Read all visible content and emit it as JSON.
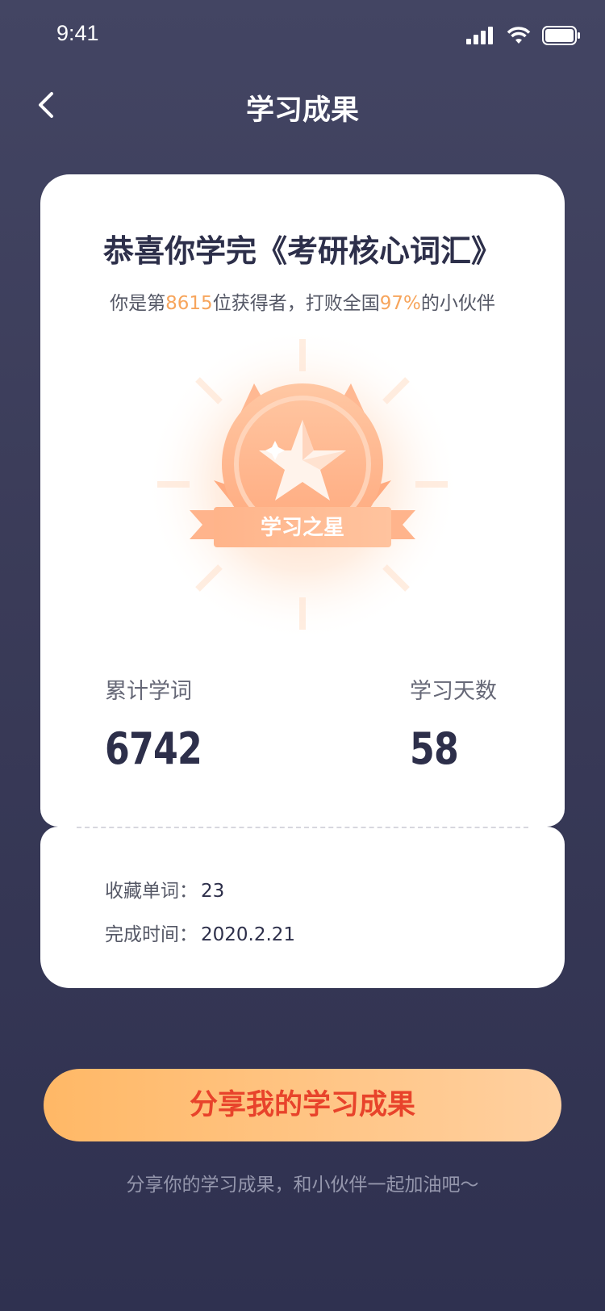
{
  "status_bar": {
    "time": "9:41"
  },
  "nav": {
    "title": "学习成果"
  },
  "card": {
    "headline": "恭喜你学完《考研核心词汇》",
    "sub_prefix": "你是第",
    "rank": "8615",
    "sub_mid": "位获得者，打败全国",
    "percent": "97%",
    "sub_suffix": "的小伙伴",
    "badge_text": "学习之星",
    "stats": [
      {
        "label": "累计学词",
        "value": "6742"
      },
      {
        "label": "学习天数",
        "value": "58"
      }
    ],
    "info": [
      {
        "label": "收藏单词：",
        "value": "23"
      },
      {
        "label": "完成时间：",
        "value": "2020.2.21"
      }
    ]
  },
  "share": {
    "button_label": "分享我的学习成果",
    "tip": "分享你的学习成果，和小伙伴一起加油吧～"
  },
  "colors": {
    "accent": "#f7a55c",
    "button_text": "#e8432b",
    "background": "#3a3b58"
  }
}
